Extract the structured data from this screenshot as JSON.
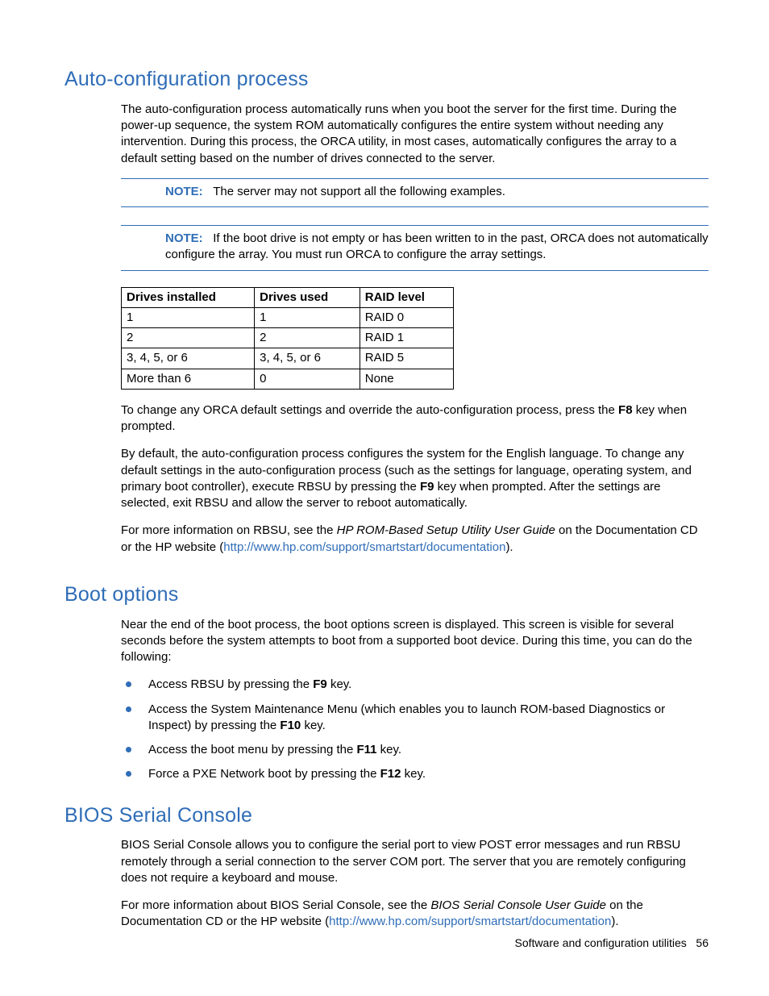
{
  "section1": {
    "title": "Auto-configuration process",
    "para1": "The auto-configuration process automatically runs when you boot the server for the first time. During the power-up sequence, the system ROM automatically configures the entire system without needing any intervention. During this process, the ORCA utility, in most cases, automatically configures the array to a default setting based on the number of drives connected to the server.",
    "note1_label": "NOTE:",
    "note1_text": "The server may not support all the following examples.",
    "note2_label": "NOTE:",
    "note2_text": "If the boot drive is not empty or has been written to in the past, ORCA does not automatically configure the array. You must run ORCA to configure the array settings.",
    "table": {
      "headers": [
        "Drives installed",
        "Drives used",
        "RAID level"
      ],
      "rows": [
        [
          "1",
          "1",
          "RAID 0"
        ],
        [
          "2",
          "2",
          "RAID 1"
        ],
        [
          "3, 4, 5, or 6",
          "3, 4, 5, or 6",
          "RAID 5"
        ],
        [
          "More than 6",
          "0",
          "None"
        ]
      ]
    },
    "para2_a": "To change any ORCA default settings and override the auto-configuration process, press the ",
    "para2_key": "F8",
    "para2_b": " key when prompted.",
    "para3_a": "By default, the auto-configuration process configures the system for the English language. To change any default settings in the auto-configuration process (such as the settings for language, operating system, and primary boot controller), execute RBSU by pressing the ",
    "para3_key": "F9",
    "para3_b": " key when prompted. After the settings are selected, exit RBSU and allow the server to reboot automatically.",
    "para4_a": "For more information on RBSU, see the ",
    "para4_em": "HP ROM-Based Setup Utility User Guide",
    "para4_b": " on the Documentation CD or the HP website (",
    "para4_link": "http://www.hp.com/support/smartstart/documentation",
    "para4_c": ")."
  },
  "section2": {
    "title": "Boot options",
    "para1": "Near the end of the boot process, the boot options screen is displayed. This screen is visible for several seconds before the system attempts to boot from a supported boot device. During this time, you can do the following:",
    "bullets": [
      {
        "a": "Access RBSU by pressing the ",
        "key": "F9",
        "b": " key."
      },
      {
        "a": "Access the System Maintenance Menu (which enables you to launch ROM-based Diagnostics or Inspect) by pressing the ",
        "key": "F10",
        "b": " key."
      },
      {
        "a": "Access the boot menu by pressing the ",
        "key": "F11",
        "b": " key."
      },
      {
        "a": "Force a PXE Network boot by pressing the ",
        "key": "F12",
        "b": " key."
      }
    ]
  },
  "section3": {
    "title": "BIOS Serial Console",
    "para1": "BIOS Serial Console allows you to configure the serial port to view POST error messages and run RBSU remotely through a serial connection to the server COM port. The server that you are remotely configuring does not require a keyboard and mouse.",
    "para2_a": "For more information about BIOS Serial Console, see the ",
    "para2_em": "BIOS Serial Console User Guide",
    "para2_b": " on the Documentation CD or the HP website (",
    "para2_link": "http://www.hp.com/support/smartstart/documentation",
    "para2_c": ")."
  },
  "footer": {
    "text": "Software and configuration utilities",
    "page": "56"
  }
}
